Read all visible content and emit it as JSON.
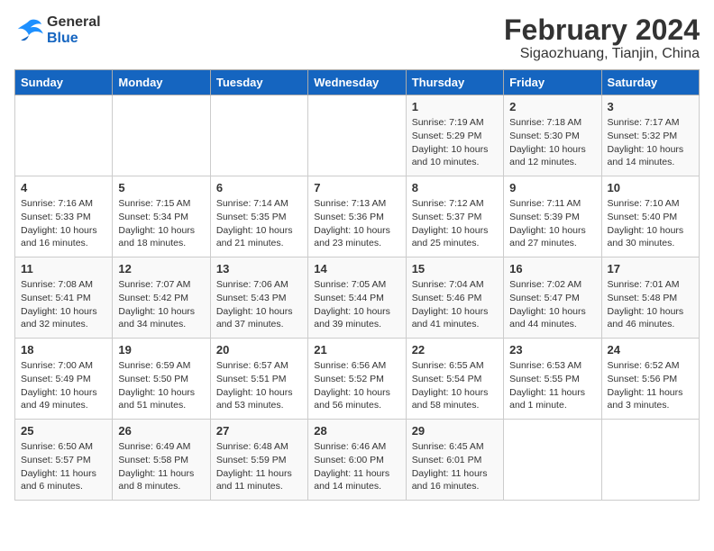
{
  "logo": {
    "line1": "General",
    "line2": "Blue"
  },
  "title": "February 2024",
  "subtitle": "Sigaozhuang, Tianjin, China",
  "days_of_week": [
    "Sunday",
    "Monday",
    "Tuesday",
    "Wednesday",
    "Thursday",
    "Friday",
    "Saturday"
  ],
  "weeks": [
    [
      {
        "day": "",
        "info": ""
      },
      {
        "day": "",
        "info": ""
      },
      {
        "day": "",
        "info": ""
      },
      {
        "day": "",
        "info": ""
      },
      {
        "day": "1",
        "info": "Sunrise: 7:19 AM\nSunset: 5:29 PM\nDaylight: 10 hours\nand 10 minutes."
      },
      {
        "day": "2",
        "info": "Sunrise: 7:18 AM\nSunset: 5:30 PM\nDaylight: 10 hours\nand 12 minutes."
      },
      {
        "day": "3",
        "info": "Sunrise: 7:17 AM\nSunset: 5:32 PM\nDaylight: 10 hours\nand 14 minutes."
      }
    ],
    [
      {
        "day": "4",
        "info": "Sunrise: 7:16 AM\nSunset: 5:33 PM\nDaylight: 10 hours\nand 16 minutes."
      },
      {
        "day": "5",
        "info": "Sunrise: 7:15 AM\nSunset: 5:34 PM\nDaylight: 10 hours\nand 18 minutes."
      },
      {
        "day": "6",
        "info": "Sunrise: 7:14 AM\nSunset: 5:35 PM\nDaylight: 10 hours\nand 21 minutes."
      },
      {
        "day": "7",
        "info": "Sunrise: 7:13 AM\nSunset: 5:36 PM\nDaylight: 10 hours\nand 23 minutes."
      },
      {
        "day": "8",
        "info": "Sunrise: 7:12 AM\nSunset: 5:37 PM\nDaylight: 10 hours\nand 25 minutes."
      },
      {
        "day": "9",
        "info": "Sunrise: 7:11 AM\nSunset: 5:39 PM\nDaylight: 10 hours\nand 27 minutes."
      },
      {
        "day": "10",
        "info": "Sunrise: 7:10 AM\nSunset: 5:40 PM\nDaylight: 10 hours\nand 30 minutes."
      }
    ],
    [
      {
        "day": "11",
        "info": "Sunrise: 7:08 AM\nSunset: 5:41 PM\nDaylight: 10 hours\nand 32 minutes."
      },
      {
        "day": "12",
        "info": "Sunrise: 7:07 AM\nSunset: 5:42 PM\nDaylight: 10 hours\nand 34 minutes."
      },
      {
        "day": "13",
        "info": "Sunrise: 7:06 AM\nSunset: 5:43 PM\nDaylight: 10 hours\nand 37 minutes."
      },
      {
        "day": "14",
        "info": "Sunrise: 7:05 AM\nSunset: 5:44 PM\nDaylight: 10 hours\nand 39 minutes."
      },
      {
        "day": "15",
        "info": "Sunrise: 7:04 AM\nSunset: 5:46 PM\nDaylight: 10 hours\nand 41 minutes."
      },
      {
        "day": "16",
        "info": "Sunrise: 7:02 AM\nSunset: 5:47 PM\nDaylight: 10 hours\nand 44 minutes."
      },
      {
        "day": "17",
        "info": "Sunrise: 7:01 AM\nSunset: 5:48 PM\nDaylight: 10 hours\nand 46 minutes."
      }
    ],
    [
      {
        "day": "18",
        "info": "Sunrise: 7:00 AM\nSunset: 5:49 PM\nDaylight: 10 hours\nand 49 minutes."
      },
      {
        "day": "19",
        "info": "Sunrise: 6:59 AM\nSunset: 5:50 PM\nDaylight: 10 hours\nand 51 minutes."
      },
      {
        "day": "20",
        "info": "Sunrise: 6:57 AM\nSunset: 5:51 PM\nDaylight: 10 hours\nand 53 minutes."
      },
      {
        "day": "21",
        "info": "Sunrise: 6:56 AM\nSunset: 5:52 PM\nDaylight: 10 hours\nand 56 minutes."
      },
      {
        "day": "22",
        "info": "Sunrise: 6:55 AM\nSunset: 5:54 PM\nDaylight: 10 hours\nand 58 minutes."
      },
      {
        "day": "23",
        "info": "Sunrise: 6:53 AM\nSunset: 5:55 PM\nDaylight: 11 hours\nand 1 minute."
      },
      {
        "day": "24",
        "info": "Sunrise: 6:52 AM\nSunset: 5:56 PM\nDaylight: 11 hours\nand 3 minutes."
      }
    ],
    [
      {
        "day": "25",
        "info": "Sunrise: 6:50 AM\nSunset: 5:57 PM\nDaylight: 11 hours\nand 6 minutes."
      },
      {
        "day": "26",
        "info": "Sunrise: 6:49 AM\nSunset: 5:58 PM\nDaylight: 11 hours\nand 8 minutes."
      },
      {
        "day": "27",
        "info": "Sunrise: 6:48 AM\nSunset: 5:59 PM\nDaylight: 11 hours\nand 11 minutes."
      },
      {
        "day": "28",
        "info": "Sunrise: 6:46 AM\nSunset: 6:00 PM\nDaylight: 11 hours\nand 14 minutes."
      },
      {
        "day": "29",
        "info": "Sunrise: 6:45 AM\nSunset: 6:01 PM\nDaylight: 11 hours\nand 16 minutes."
      },
      {
        "day": "",
        "info": ""
      },
      {
        "day": "",
        "info": ""
      }
    ]
  ]
}
